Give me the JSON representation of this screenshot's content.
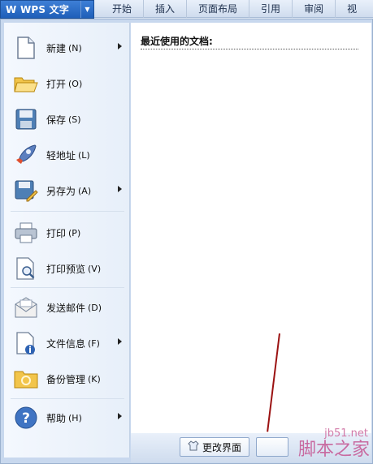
{
  "app": {
    "logo_glyph": "W",
    "title": "WPS 文字",
    "dropdown_glyph": "▼"
  },
  "tabs": [
    {
      "label": "开始"
    },
    {
      "label": "插入"
    },
    {
      "label": "页面布局"
    },
    {
      "label": "引用"
    },
    {
      "label": "审阅"
    },
    {
      "label": "视"
    }
  ],
  "menu": {
    "items": [
      {
        "label": "新建",
        "accel": "(N)",
        "icon": "new-document-icon",
        "submenu": true
      },
      {
        "label": "打开",
        "accel": "(O)",
        "icon": "folder-open-icon",
        "submenu": false
      },
      {
        "label": "保存",
        "accel": "(S)",
        "icon": "save-icon",
        "submenu": false
      },
      {
        "label": "轻地址",
        "accel": "(L)",
        "icon": "rocket-icon",
        "submenu": false
      },
      {
        "label": "另存为",
        "accel": "(A)",
        "icon": "save-as-icon",
        "submenu": true
      },
      {
        "label": "打印",
        "accel": "(P)",
        "icon": "printer-icon",
        "submenu": false
      },
      {
        "label": "打印预览",
        "accel": "(V)",
        "icon": "print-preview-icon",
        "submenu": false
      },
      {
        "label": "发送邮件",
        "accel": "(D)",
        "icon": "mail-icon",
        "submenu": false
      },
      {
        "label": "文件信息",
        "accel": "(F)",
        "icon": "file-info-icon",
        "submenu": true
      },
      {
        "label": "备份管理",
        "accel": "(K)",
        "icon": "backup-folder-icon",
        "submenu": false
      },
      {
        "label": "帮助",
        "accel": "(H)",
        "icon": "help-icon",
        "submenu": true
      }
    ]
  },
  "recent": {
    "title": "最近使用的文档:"
  },
  "bottom": {
    "change_ui_label": "更改界面"
  },
  "watermark": {
    "url": "jb51.net",
    "name": "脚本之家"
  },
  "colors": {
    "accent": "#1f5fb9",
    "annotation_line": "#9b1212"
  }
}
